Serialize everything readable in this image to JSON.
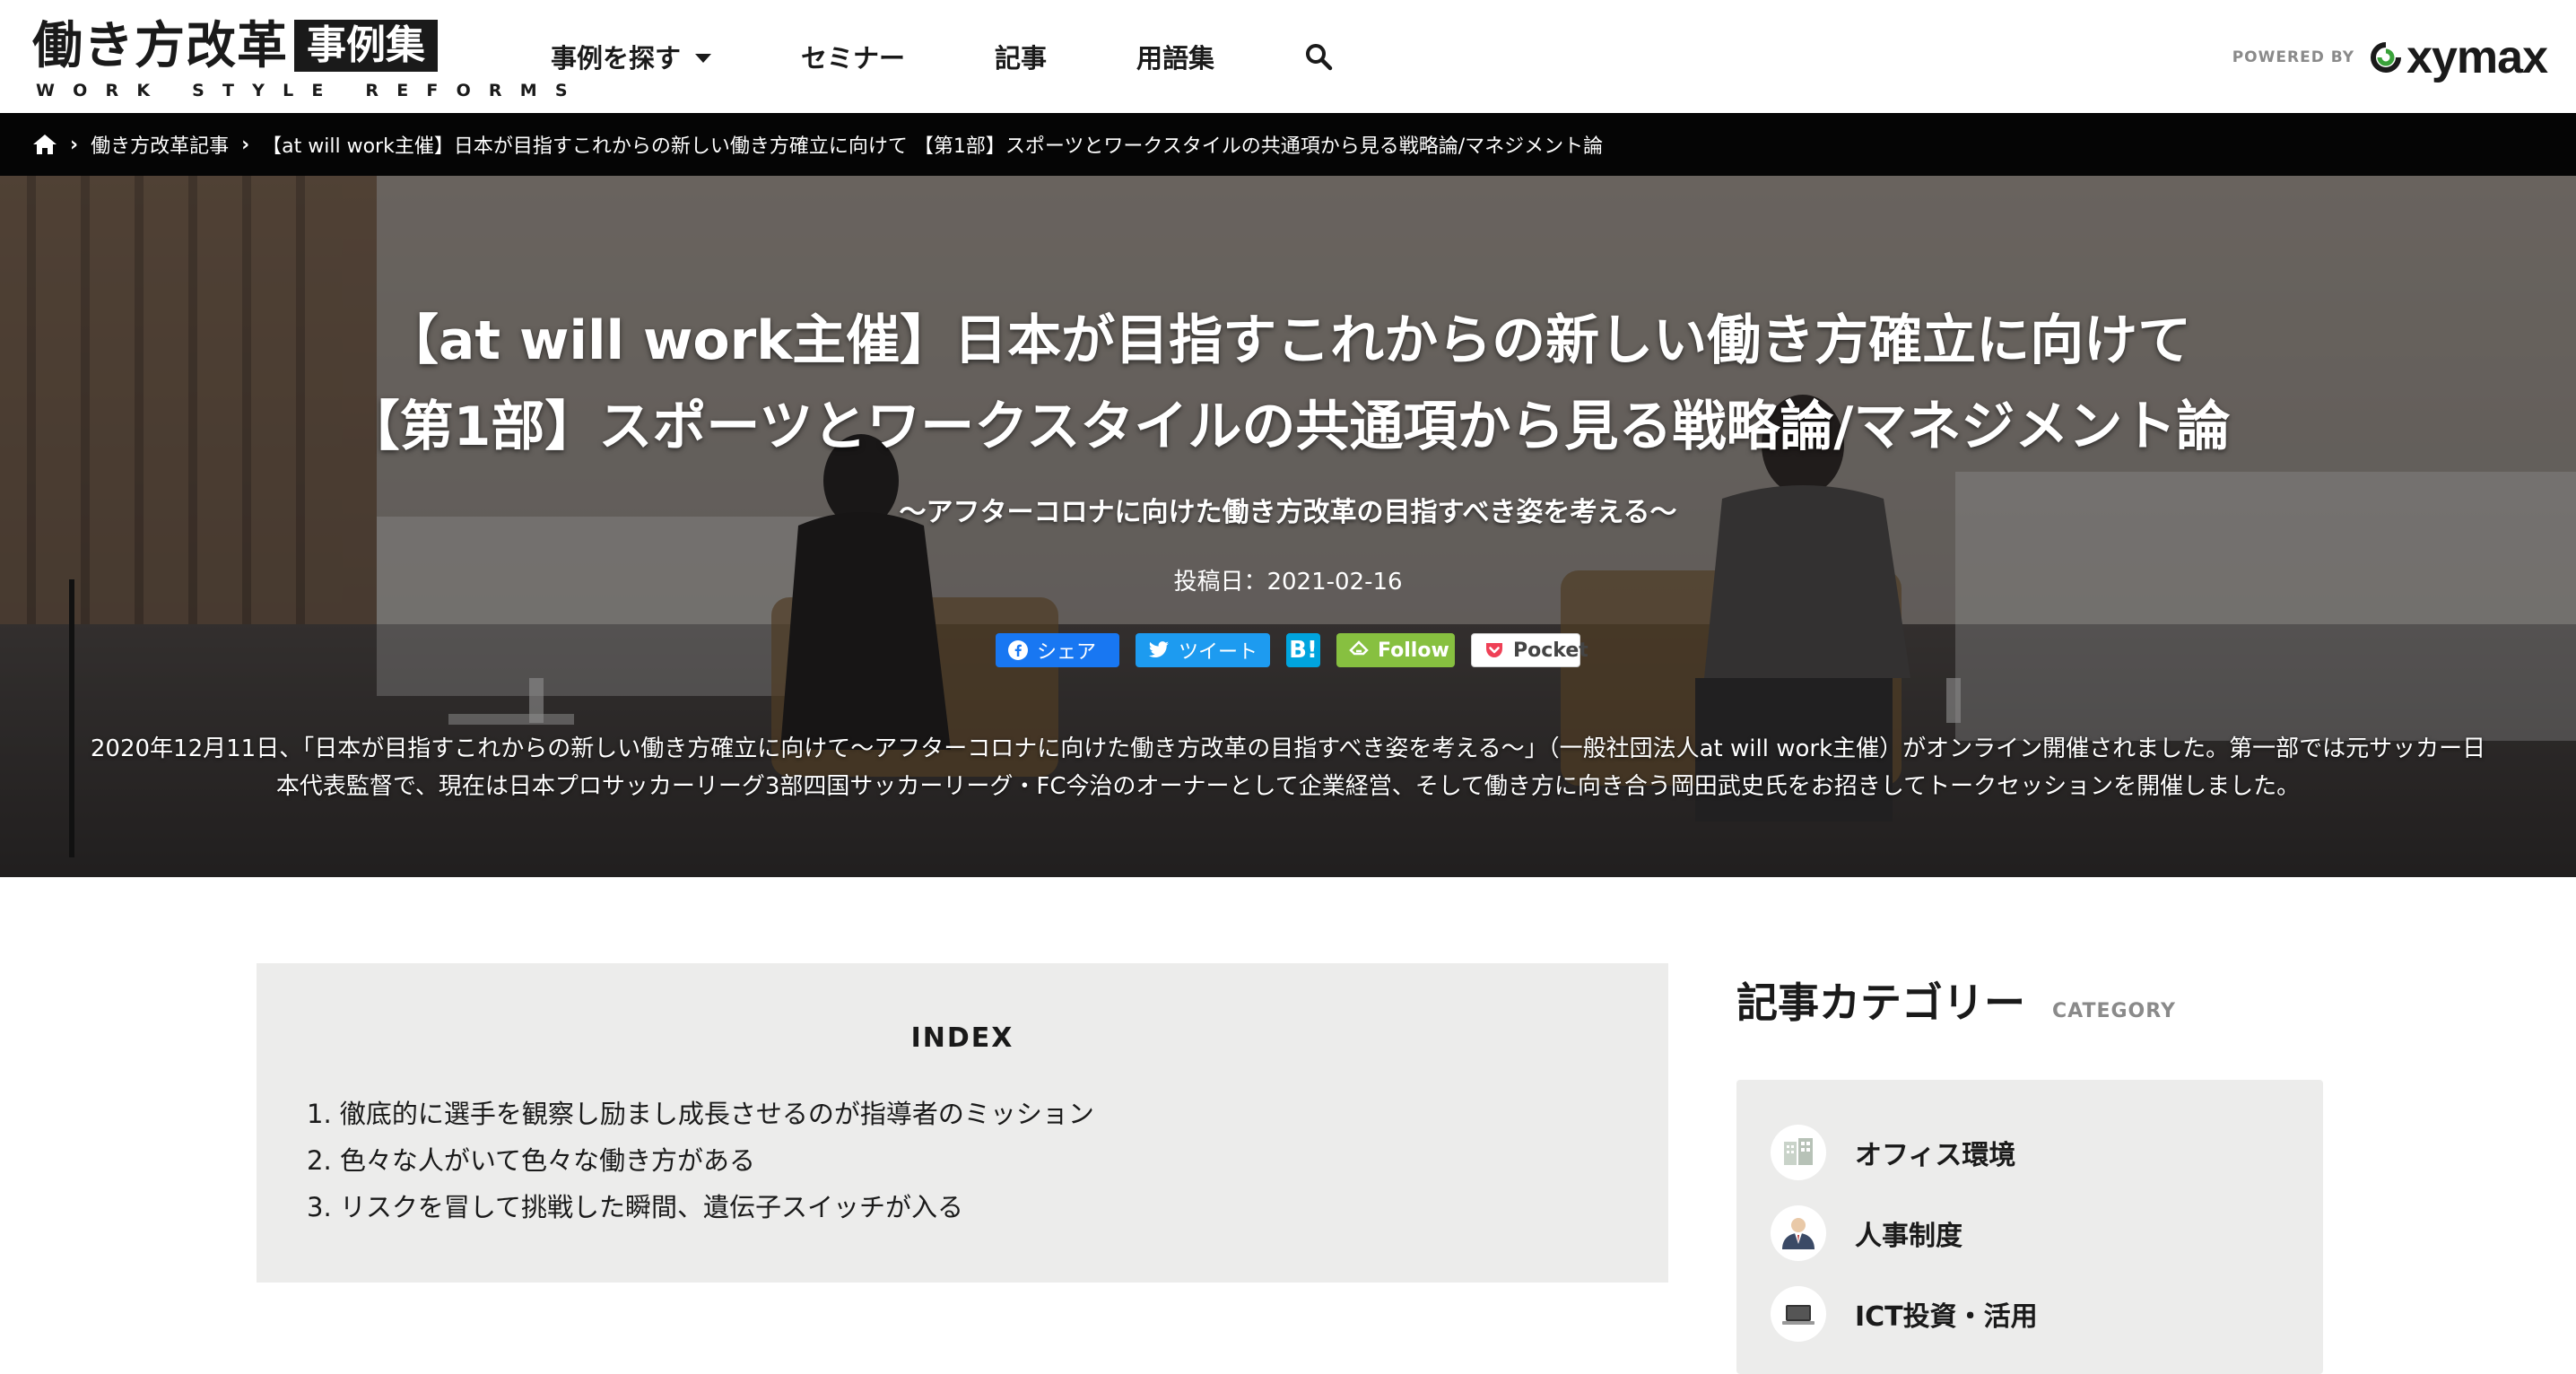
{
  "logo": {
    "main": "働き方改革",
    "badge": "事例集",
    "sub": "WORK STYLE REFORMS"
  },
  "nav": {
    "find": "事例を探す",
    "seminar": "セミナー",
    "article": "記事",
    "glossary": "用語集",
    "search_icon": "search-icon"
  },
  "powered": {
    "label": "POWERED BY",
    "brand": "xymax"
  },
  "breadcrumb": {
    "home_icon": "home-icon",
    "items": [
      "働き方改革記事",
      "【at will work主催】日本が目指すこれからの新しい働き方確立に向けて 【第1部】スポーツとワークスタイルの共通項から見る戦略論/マネジメント論"
    ]
  },
  "hero": {
    "title_line1": "【at will work主催】日本が目指すこれからの新しい働き方確立に向けて",
    "title_line2": "【第1部】スポーツとワークスタイルの共通項から見る戦略論/マネジメント論",
    "subtitle": "〜アフターコロナに向けた働き方改革の目指すべき姿を考える〜",
    "date": "投稿日：2021-02-16",
    "share": {
      "facebook": "シェア",
      "twitter": "ツイート",
      "hatena": "B!",
      "feedly": "Follow",
      "pocket": "Pocket"
    },
    "description": "2020年12月11日、「日本が目指すこれからの新しい働き方確立に向けて〜アフターコロナに向けた働き方改革の目指すべき姿を考える〜」（一般社団法人at will work主催）がオンライン開催されました。第一部では元サッカー日本代表監督で、現在は日本プロサッカーリーグ3部四国サッカーリーグ・FC今治のオーナーとして企業経営、そして働き方に向き合う岡田武史氏をお招きしてトークセッションを開催しました。"
  },
  "index": {
    "title": "INDEX",
    "items": [
      "1. 徹底的に選手を観察し励まし成長させるのが指導者のミッション",
      "2. 色々な人がいて色々な働き方がある",
      "3. リスクを冒して挑戦した瞬間、遺伝子スイッチが入る"
    ]
  },
  "sidebar": {
    "title": "記事カテゴリー",
    "sub": "CATEGORY",
    "categories": [
      {
        "label": "オフィス環境",
        "icon": "office-icon"
      },
      {
        "label": "人事制度",
        "icon": "person-icon"
      },
      {
        "label": "ICT投資・活用",
        "icon": "laptop-icon"
      }
    ]
  },
  "colors": {
    "breadcrumb_bg": "#050505",
    "index_bg": "#ececeb",
    "facebook": "#1877f2",
    "twitter": "#1d9bf0",
    "hatena": "#00a4de",
    "feedly": "#87c040"
  }
}
